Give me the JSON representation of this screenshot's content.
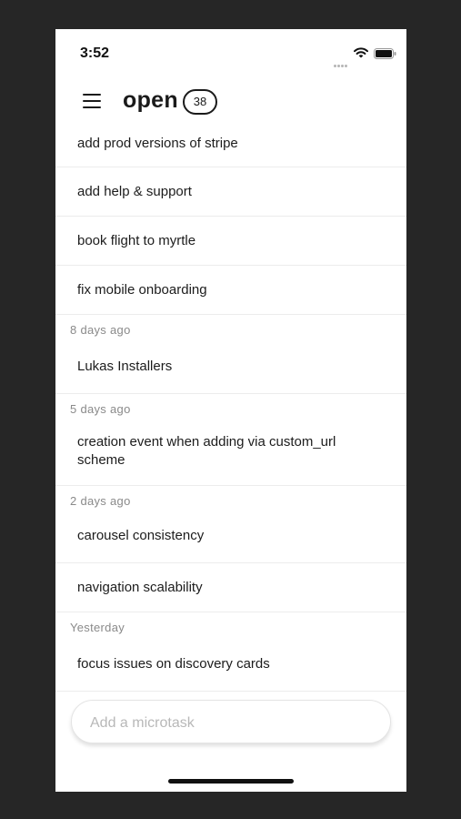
{
  "status_bar": {
    "time": "3:52"
  },
  "header": {
    "title": "open",
    "count": "38"
  },
  "groups": [
    {
      "label": "",
      "tasks": [
        "add prod versions of stripe",
        "add help & support",
        "book flight to myrtle",
        "fix mobile onboarding"
      ]
    },
    {
      "label": "8 days ago",
      "tasks": [
        "Lukas Installers"
      ]
    },
    {
      "label": "5 days ago",
      "tasks": [
        "creation event when adding via custom_url scheme"
      ]
    },
    {
      "label": "2 days ago",
      "tasks": [
        "carousel consistency",
        "navigation scalability"
      ]
    },
    {
      "label": "Yesterday",
      "tasks": [
        "focus issues on discovery cards"
      ]
    }
  ],
  "composer": {
    "placeholder": "Add a microtask",
    "value": ""
  },
  "colors": {
    "background": "#262626",
    "surface": "#ffffff",
    "text": "#1a1a1a",
    "muted": "#8a8a8a",
    "divider": "#ececec"
  }
}
